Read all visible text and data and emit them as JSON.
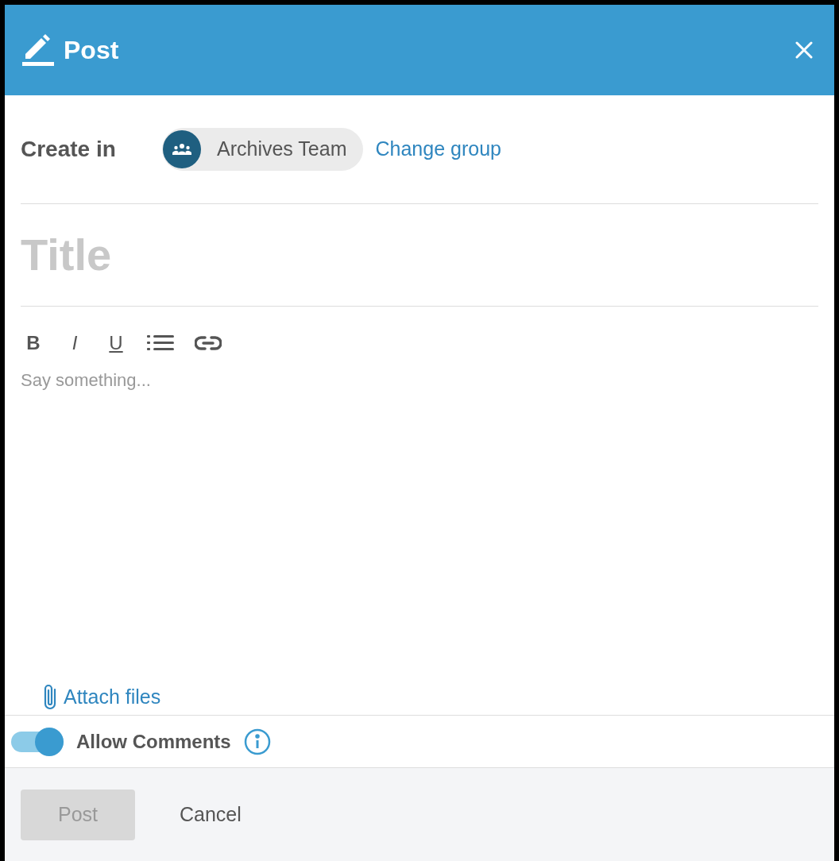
{
  "header": {
    "title": "Post"
  },
  "create_in": {
    "label": "Create in",
    "group": "Archives Team",
    "change_link": "Change group"
  },
  "title_field": {
    "placeholder": "Title"
  },
  "toolbar": [
    {
      "kind": "bold",
      "label": "B"
    },
    {
      "kind": "italic",
      "label": "I"
    },
    {
      "kind": "underline",
      "label": "U"
    },
    {
      "kind": "list"
    },
    {
      "kind": "link"
    }
  ],
  "editor": {
    "placeholder": "Say something..."
  },
  "attach": {
    "label": "Attach files"
  },
  "allow_comments": {
    "label": "Allow Comments",
    "on": true
  },
  "buttons": [
    {
      "kind": "primary",
      "label": "Post",
      "disabled": true
    },
    {
      "kind": "plain",
      "label": "Cancel",
      "disabled": false
    }
  ]
}
